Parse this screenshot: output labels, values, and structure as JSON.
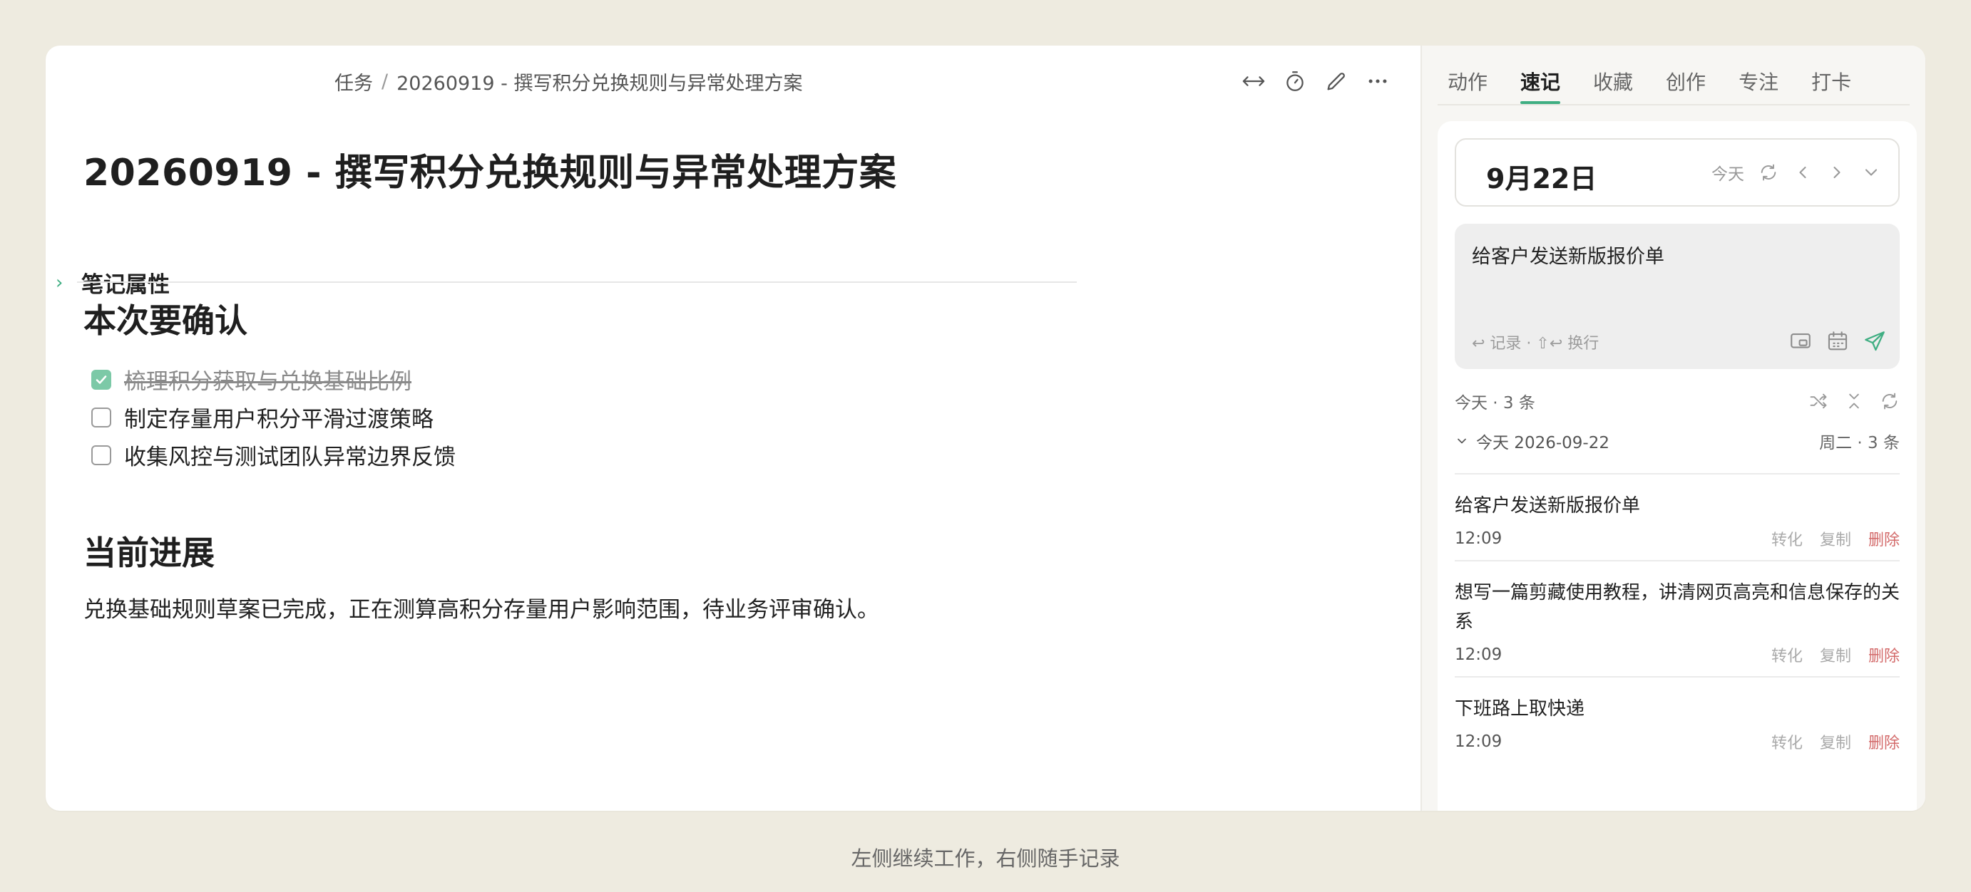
{
  "breadcrumb": {
    "parent": "任务",
    "separator": "/",
    "current": "20260919 - 撰写积分兑换规则与异常处理方案"
  },
  "toolbar": {
    "icons": [
      "expand-width-icon",
      "timer-icon",
      "edit-icon",
      "more-icon"
    ]
  },
  "document": {
    "title": "20260919 - 撰写积分兑换规则与异常处理方案",
    "properties_label": "笔记属性",
    "section1_heading": "本次要确认",
    "tasks": [
      {
        "text": "梳理积分获取与兑换基础比例",
        "done": true
      },
      {
        "text": "制定存量用户积分平滑过渡策略",
        "done": false
      },
      {
        "text": "收集风控与测试团队异常边界反馈",
        "done": false
      }
    ],
    "section2_heading": "当前进展",
    "progress_text": "兑换基础规则草案已完成，正在测算高积分存量用户影响范围，待业务评审确认。"
  },
  "sidebar": {
    "tabs": [
      "动作",
      "速记",
      "收藏",
      "创作",
      "专注",
      "打卡"
    ],
    "active_tab": "速记",
    "date_label": "9月22日",
    "today_label": "今天",
    "input_value": "给客户发送新版报价单",
    "input_hint": "↩ 记录 · ⇧↩ 换行",
    "stats": "今天 · 3 条",
    "group_label": "今天 2026-09-22",
    "group_meta": "周二 · 3 条",
    "entry_actions": {
      "convert": "转化",
      "copy": "复制",
      "delete": "删除"
    },
    "entries": [
      {
        "text": "给客户发送新版报价单",
        "time": "12:09"
      },
      {
        "text": "想写一篇剪藏使用教程，讲清网页高亮和信息保存的关系",
        "time": "12:09"
      },
      {
        "text": "下班路上取快递",
        "time": "12:09"
      }
    ]
  },
  "caption": "左侧继续工作，右侧随手记录",
  "colors": {
    "accent": "#3fae82",
    "checkbox_done": "#7cc9a7",
    "delete": "#d36a6a",
    "background": "#eeebe0"
  }
}
